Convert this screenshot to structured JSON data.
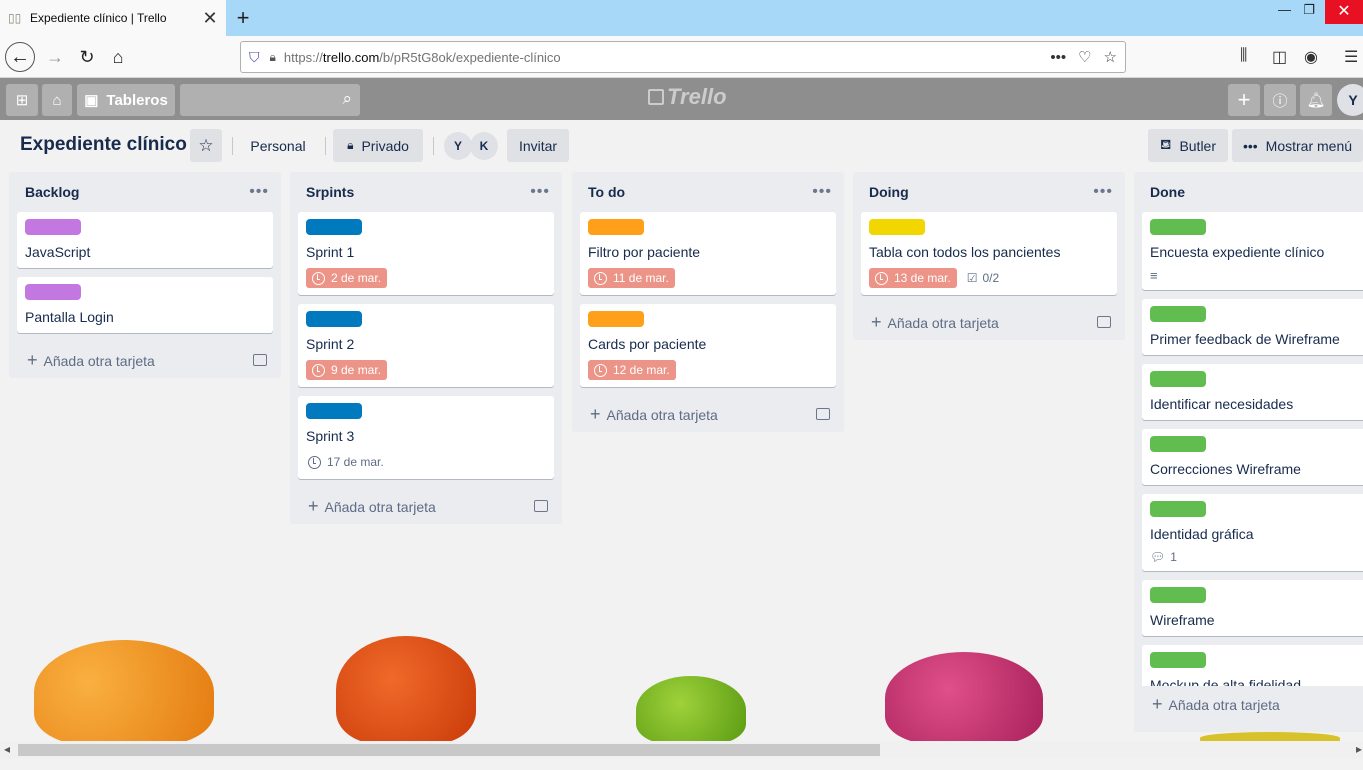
{
  "browser": {
    "tab_title": "Expediente clínico | Trello",
    "url_prefix": "https://",
    "url_host": "trello.com",
    "url_path": "/b/pR5tG8ok/expediente-clínico",
    "url_more": "•••"
  },
  "header": {
    "boards_label": "Tableros",
    "logo": "Trello",
    "user_initial": "Y"
  },
  "board": {
    "title": "Expediente clínico",
    "team_label": "Personal",
    "visibility_label": "Privado",
    "members": [
      "Y",
      "K"
    ],
    "invite_label": "Invitar",
    "butler_label": "Butler",
    "menu_label": "Mostrar menú"
  },
  "add_card_label": "Añada otra tarjeta",
  "colors": {
    "purple": "#c377e0",
    "blue": "#0079bf",
    "orange": "#ff9f1a",
    "yellow": "#f2d600",
    "green": "#61bd4f"
  },
  "lists": [
    {
      "title": "Backlog",
      "cards": [
        {
          "label_color": "purple",
          "title": "JavaScript"
        },
        {
          "label_color": "purple",
          "title": "Pantalla Login"
        }
      ]
    },
    {
      "title": "Srpints",
      "cards": [
        {
          "label_color": "blue",
          "title": "Sprint 1",
          "due": "2 de mar.",
          "overdue": true
        },
        {
          "label_color": "blue",
          "title": "Sprint 2",
          "due": "9 de mar.",
          "overdue": true
        },
        {
          "label_color": "blue",
          "title": "Sprint 3",
          "due": "17 de mar.",
          "overdue": false
        }
      ]
    },
    {
      "title": "To do",
      "cards": [
        {
          "label_color": "orange",
          "title": "Filtro por paciente",
          "due": "11 de mar.",
          "overdue": true
        },
        {
          "label_color": "orange",
          "title": "Cards por paciente",
          "due": "12 de mar.",
          "overdue": true
        }
      ]
    },
    {
      "title": "Doing",
      "cards": [
        {
          "label_color": "yellow",
          "title": "Tabla con todos los pancientes",
          "due": "13 de mar.",
          "overdue": true,
          "checklist": "0/2"
        }
      ]
    },
    {
      "title": "Done",
      "cards": [
        {
          "label_color": "green",
          "title": "Encuesta expediente clínico",
          "description": true
        },
        {
          "label_color": "green",
          "title": "Primer feedback de Wireframe"
        },
        {
          "label_color": "green",
          "title": "Identificar necesidades"
        },
        {
          "label_color": "green",
          "title": "Correcciones Wireframe"
        },
        {
          "label_color": "green",
          "title": "Identidad gráfica",
          "comments": "1"
        },
        {
          "label_color": "green",
          "title": "Wireframe"
        },
        {
          "label_color": "green",
          "title": "Mockup de alta fidelidad"
        }
      ]
    }
  ]
}
